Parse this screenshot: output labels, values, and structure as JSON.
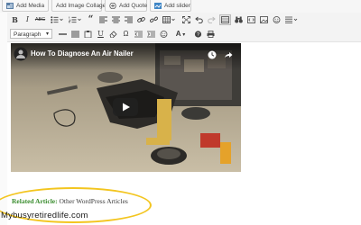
{
  "top_buttons": [
    {
      "label": "Add Media",
      "icon": "media-icon"
    },
    {
      "label": "Add Image Collage",
      "icon": "collage-icon"
    },
    {
      "label": "Add Quote",
      "icon": "quote-icon"
    },
    {
      "label": "Add slider",
      "icon": "slider-icon"
    }
  ],
  "toolbar": {
    "format_select": "Paragraph",
    "bold": "B",
    "italic": "I",
    "strike": "ABC",
    "underline": "U",
    "text_color": "A",
    "omega": "Ω"
  },
  "video": {
    "title": "How To Diagnose An Air Nailer"
  },
  "content": {
    "related_label": "Related Article:",
    "related_link": "Other WordPress Articles"
  },
  "watermark": "Mybusyretiredlife.com",
  "colors": {
    "related_label": "#3b8d2f",
    "highlight_ellipse": "#f3c51f",
    "youtube_red": "#e52d27"
  }
}
